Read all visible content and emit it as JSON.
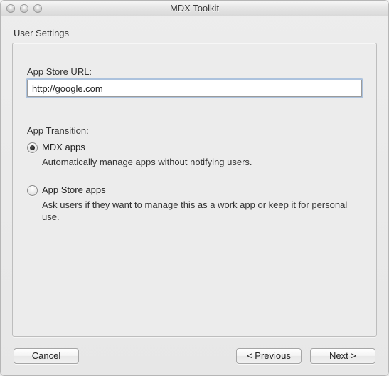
{
  "window": {
    "title": "MDX Toolkit"
  },
  "section": {
    "title": "User Settings"
  },
  "form": {
    "url_label": "App Store URL:",
    "url_value": "http://google.com",
    "transition_label": "App Transition:",
    "option_mdx": {
      "label": "MDX apps",
      "desc": "Automatically manage apps without notifying users.",
      "selected": true
    },
    "option_store": {
      "label": "App Store apps",
      "desc": "Ask users if they want to manage this as a work app or keep it for personal use.",
      "selected": false
    }
  },
  "buttons": {
    "cancel": "Cancel",
    "previous": "<  Previous",
    "next": "Next  >"
  }
}
